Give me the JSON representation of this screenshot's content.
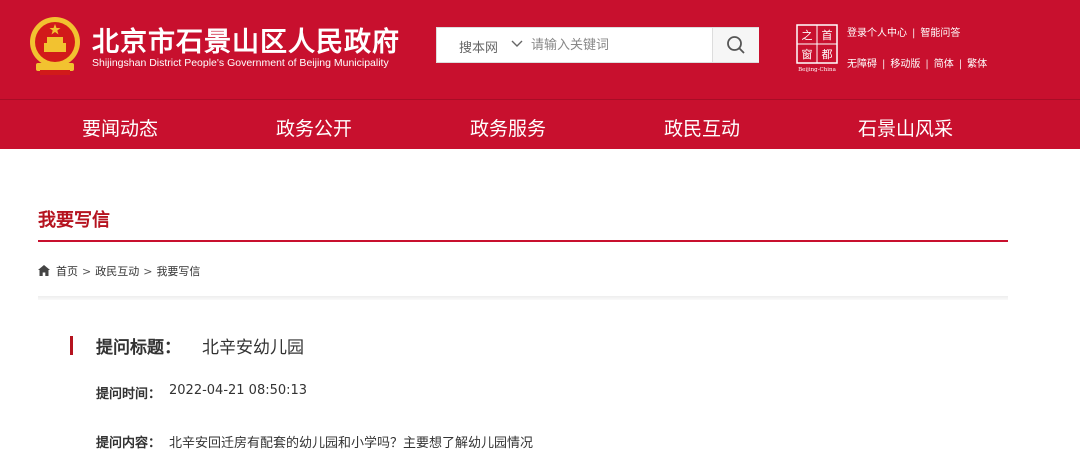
{
  "header": {
    "title": "北京市石景山区人民政府",
    "subtitle": "Shijingshan District People's Government of Beijing Municipality",
    "emblem_icon": "national-emblem-icon",
    "capital_logo_icon": "capital-window-logo-icon",
    "capital_logo_chars": [
      "之",
      "首",
      "窗",
      "都"
    ],
    "capital_logo_caption": "Beijing-China",
    "brand_color": "#c8102e"
  },
  "search": {
    "scope": "搜本网",
    "placeholder": "请输入关键词",
    "icon": "search-icon"
  },
  "top_links": {
    "row1": [
      "登录个人中心",
      "智能问答"
    ],
    "row2": [
      "无障碍",
      "移动版",
      "简体",
      "繁体"
    ],
    "separator": "|"
  },
  "nav": {
    "items": [
      "要闻动态",
      "政务公开",
      "政务服务",
      "政民互动",
      "石景山风采"
    ]
  },
  "page": {
    "section_title": "我要写信",
    "breadcrumb": [
      "首页",
      "政民互动",
      "我要写信"
    ],
    "breadcrumb_sep": ">"
  },
  "question": {
    "title_label": "提问标题：",
    "title_value": "北辛安幼儿园",
    "time_label": "提问时间：",
    "time_value": "2022-04-21 08:50:13",
    "content_label": "提问内容：",
    "content_value": "北辛安回迁房有配套的幼儿园和小学吗？主要想了解幼儿园情况"
  }
}
